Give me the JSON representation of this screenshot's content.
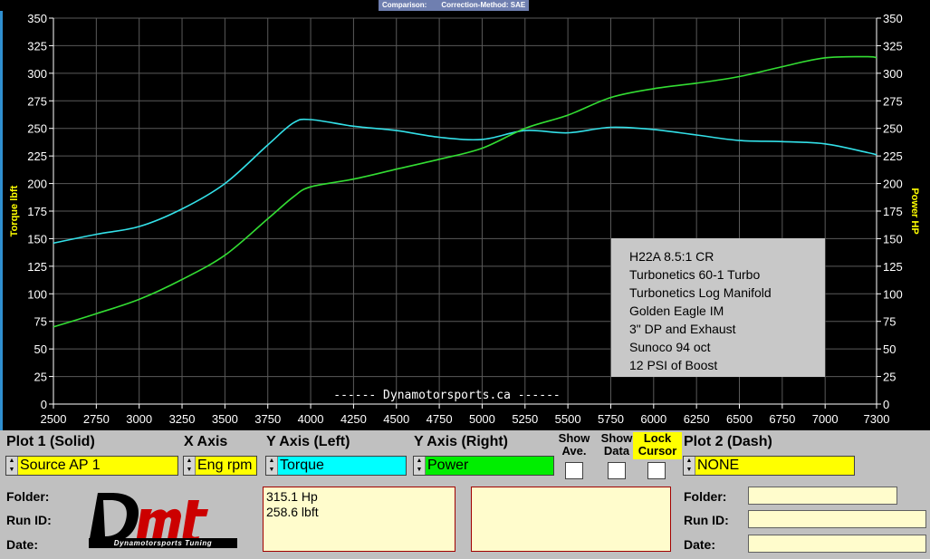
{
  "top_bar": {
    "comparison_label": "Comparison:",
    "correction_label": "Correction-Method: SAE"
  },
  "chart_data": {
    "type": "line",
    "x": [
      2500,
      2750,
      3000,
      3250,
      3500,
      3750,
      3900,
      4000,
      4250,
      4500,
      4750,
      5000,
      5250,
      5500,
      5750,
      6000,
      6250,
      6500,
      6750,
      7000,
      7250,
      7300
    ],
    "series": [
      {
        "name": "Torque",
        "axis": "left",
        "color": "#33e0e8",
        "values": [
          146,
          154,
          161,
          177,
          200,
          235,
          255,
          258,
          252,
          248,
          242,
          240,
          248,
          246,
          251,
          249,
          244,
          239,
          238,
          236,
          228,
          226
        ]
      },
      {
        "name": "Power",
        "axis": "right",
        "color": "#33dd33",
        "values": [
          70,
          82,
          95,
          113,
          135,
          168,
          188,
          197,
          204,
          213,
          222,
          232,
          250,
          262,
          278,
          286,
          291,
          297,
          306,
          314,
          315,
          314
        ]
      }
    ],
    "x_ticks": [
      "2500",
      "2750",
      "3000",
      "3250",
      "3500",
      "3750",
      "4000",
      "4250",
      "4500",
      "4750",
      "5000",
      "5250",
      "5500",
      "5750",
      "6000",
      "6250",
      "6500",
      "6750",
      "7000",
      "7300"
    ],
    "y_ticks": [
      "0",
      "25",
      "50",
      "75",
      "100",
      "125",
      "150",
      "175",
      "200",
      "225",
      "250",
      "275",
      "300",
      "325",
      "350"
    ],
    "xlim": [
      2500,
      7300
    ],
    "ylim_left": [
      0,
      350
    ],
    "ylim_right": [
      0,
      350
    ],
    "ylabel_left": "Torque lbft",
    "ylabel_right": "Power HP",
    "grid": true,
    "watermark": "------ Dynamotorsports.ca ------",
    "annotation_lines": [
      "H22A 8.5:1 CR",
      "Turbonetics 60-1 Turbo",
      "Turbonetics Log Manifold",
      "Golden Eagle IM",
      "3\" DP and Exhaust",
      "Sunoco 94 oct",
      "12 PSI of Boost"
    ]
  },
  "controls": {
    "plot1_header": "Plot 1 (Solid)",
    "xaxis_header": "X Axis",
    "yaxis_left_header": "Y Axis (Left)",
    "yaxis_right_header": "Y Axis (Right)",
    "show_ave_label": "Show Ave.",
    "show_data_label": "Show Data",
    "lock_cursor_label": "Lock Cursor",
    "plot2_header": "Plot 2 (Dash)",
    "plot1_value": "Source AP 1",
    "xaxis_value": "Eng rpm",
    "yaxis_left_value": "Torque",
    "yaxis_right_value": "Power",
    "plot2_value": "NONE",
    "folder_label": "Folder:",
    "runid_label": "Run ID:",
    "date_label": "Date:",
    "readout": "315.1 Hp\n258.6 lbft",
    "logo_text": "Dmt",
    "logo_subtitle": "Dynamotorsports Tuning",
    "colors": {
      "plot_yellow": "#ffff00",
      "torque_cyan": "#00ffff",
      "power_green": "#00ee00"
    }
  }
}
